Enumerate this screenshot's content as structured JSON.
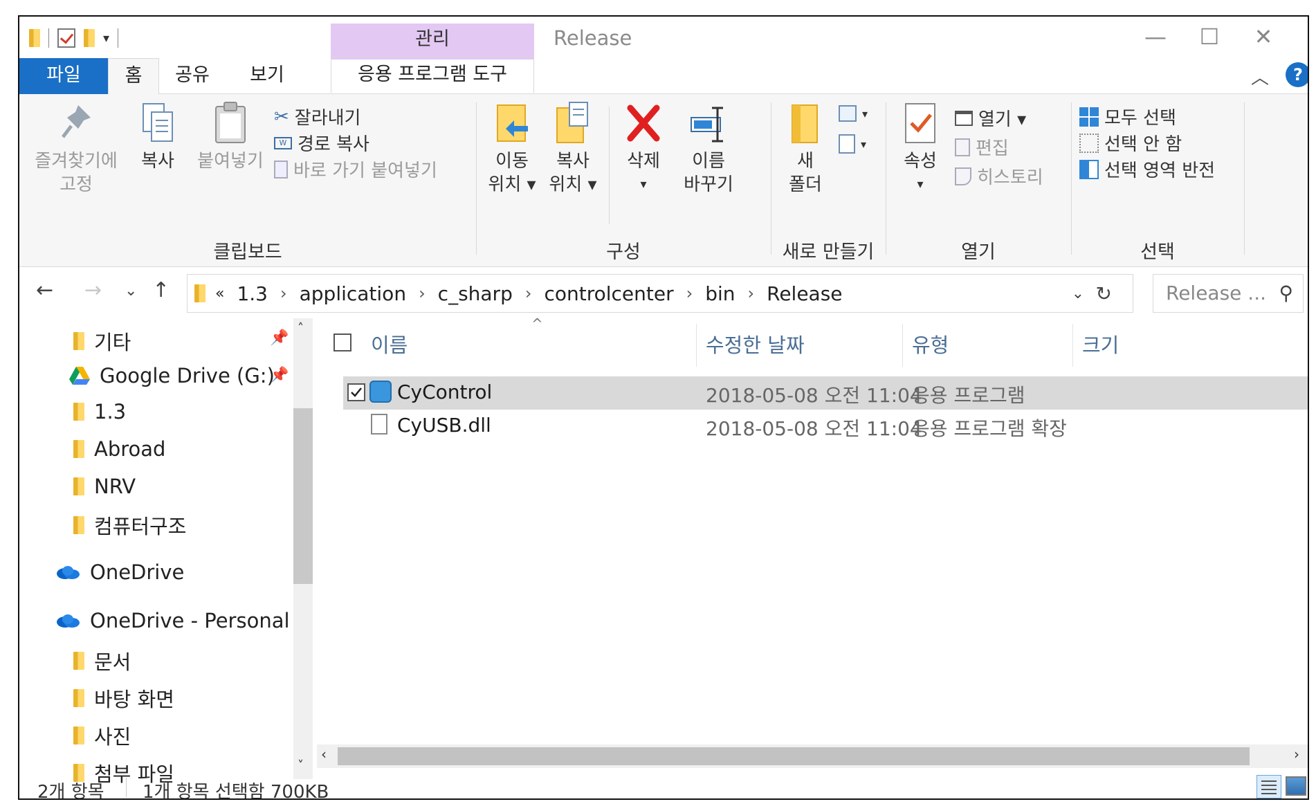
{
  "title_bar": {
    "window_title": "Release",
    "context_tab": "관리",
    "minimize": "—",
    "maximize": "☐",
    "close": "✕"
  },
  "tabs": {
    "file": "파일",
    "home": "홈",
    "share": "공유",
    "view": "보기",
    "app_tools": "응용 프로그램 도구"
  },
  "ribbon": {
    "clipboard": {
      "pin_line1": "즐겨찾기에",
      "pin_line2": "고정",
      "copy": "복사",
      "paste": "붙여넣기",
      "cut": "잘라내기",
      "copy_path": "경로 복사",
      "paste_shortcut": "바로 가기 붙여넣기",
      "label": "클립보드"
    },
    "organize": {
      "move_line1": "이동",
      "move_line2": "위치 ▾",
      "copyto_line1": "복사",
      "copyto_line2": "위치 ▾",
      "delete": "삭제",
      "delete_arrow": "▾",
      "rename_line1": "이름",
      "rename_line2": "바꾸기",
      "label": "구성"
    },
    "new": {
      "folder_line1": "새",
      "folder_line2": "폴더",
      "label": "새로 만들기"
    },
    "open": {
      "props": "속성",
      "props_arrow": "▾",
      "open": "열기 ▾",
      "edit": "편집",
      "history": "히스토리",
      "label": "열기"
    },
    "select": {
      "all": "모두 선택",
      "none": "선택 안 함",
      "invert": "선택 영역 반전",
      "label": "선택"
    }
  },
  "address": {
    "chevrons": "«",
    "crumbs": [
      "1.3",
      "application",
      "c_sharp",
      "controlcenter",
      "bin",
      "Release"
    ],
    "search_placeholder": "Release ..."
  },
  "nav_pane": {
    "items": [
      "기타",
      "Google Drive (G:)",
      "1.3",
      "Abroad",
      "NRV",
      "컴퓨터구조",
      "OneDrive",
      "OneDrive - Personal",
      "문서",
      "바탕 화면",
      "사진",
      "첨부 파일"
    ]
  },
  "columns": {
    "name": "이름",
    "date": "수정한 날짜",
    "type": "유형",
    "size": "크기"
  },
  "files": [
    {
      "name": "CyControl",
      "date": "2018-05-08 오전 11:04",
      "type": "응용 프로그램",
      "selected": true
    },
    {
      "name": "CyUSB.dll",
      "date": "2018-05-08 오전 11:04",
      "type": "응용 프로그램 확장",
      "selected": false
    }
  ],
  "status": {
    "count": "2개 항목",
    "selection": "1개 항목 선택함 700KB"
  },
  "colors": {
    "file_tab": "#1a6fc6",
    "context_tab": "#e3c8f3",
    "selection": "#d9d9d9",
    "folder": "#ffd86b"
  }
}
